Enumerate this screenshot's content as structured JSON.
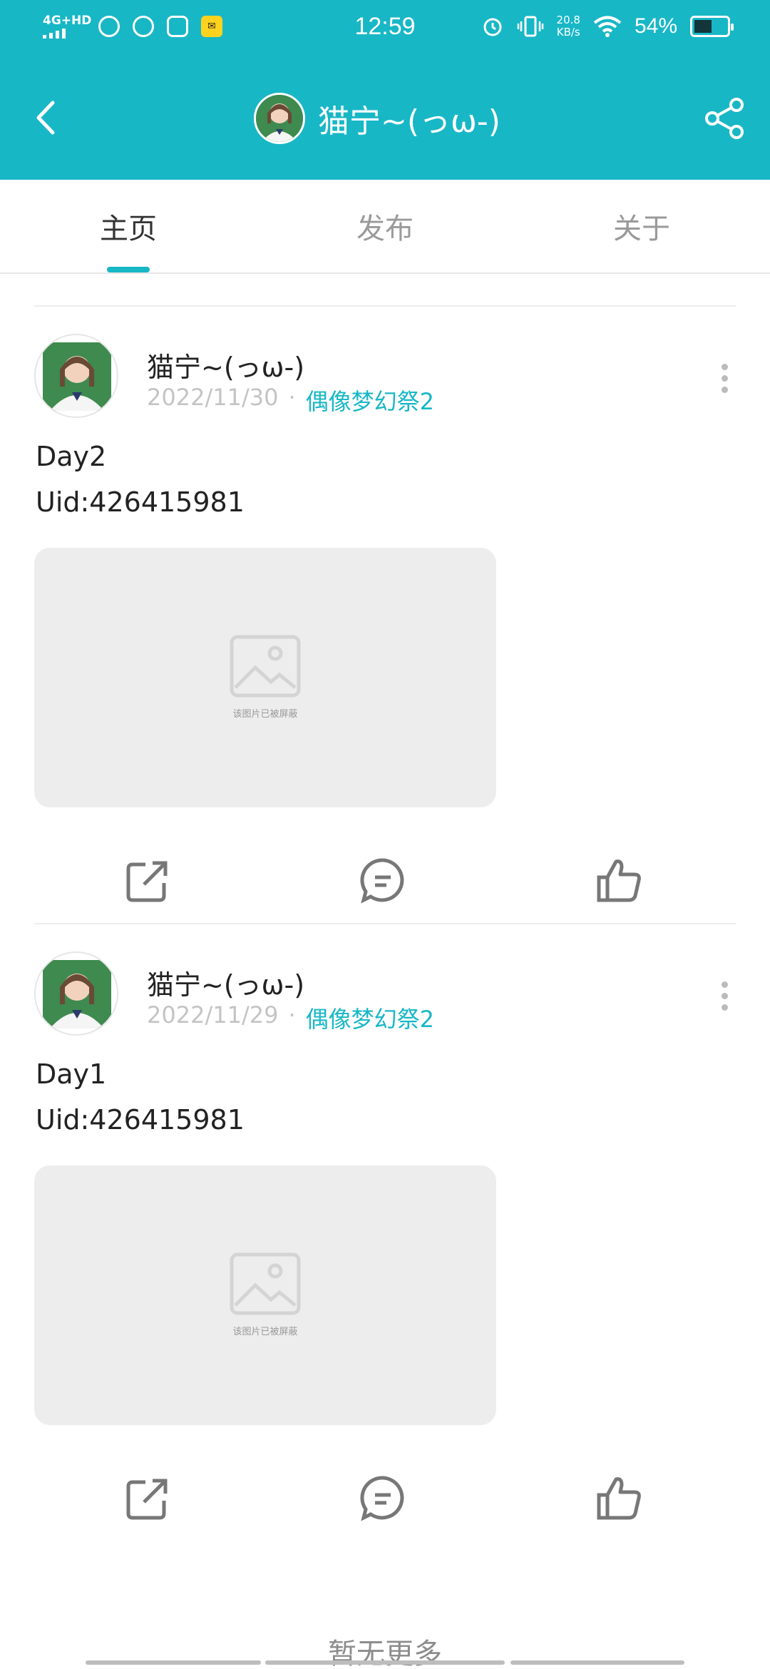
{
  "status_bar": {
    "network": "4G+HD",
    "time": "12:59",
    "speed_value": "20.8",
    "speed_unit": "KB/s",
    "battery": "54%",
    "battery_level": 0.54,
    "icons": [
      "netease-music-icon",
      "weibo-icon",
      "video-app-icon",
      "app-badge-icon",
      "alarm-icon",
      "vibrate-icon",
      "wifi-icon",
      "battery-icon"
    ]
  },
  "header": {
    "title": "猫宁~(っω-)",
    "back_icon": "chevron-left-icon",
    "share_icon": "share-icon"
  },
  "tabs": [
    {
      "label": "主页",
      "active": true
    },
    {
      "label": "发布",
      "active": false
    },
    {
      "label": "关于",
      "active": false
    }
  ],
  "posts": [
    {
      "author": "猫宁~(っω-)",
      "date": "2022/11/30",
      "separator": "·",
      "game": "偶像梦幻祭2",
      "lines": [
        "Day2",
        "Uid:426415981"
      ],
      "image_caption": "该图片已被屏蔽"
    },
    {
      "author": "猫宁~(っω-)",
      "date": "2022/11/29",
      "separator": "·",
      "game": "偶像梦幻祭2",
      "lines": [
        "Day1",
        "Uid:426415981"
      ],
      "image_caption": "该图片已被屏蔽"
    }
  ],
  "footer": {
    "no_more": "暂无更多"
  },
  "colors": {
    "accent": "#18b7c6",
    "muted": "#c4c4c4",
    "placeholder": "#ededed"
  }
}
